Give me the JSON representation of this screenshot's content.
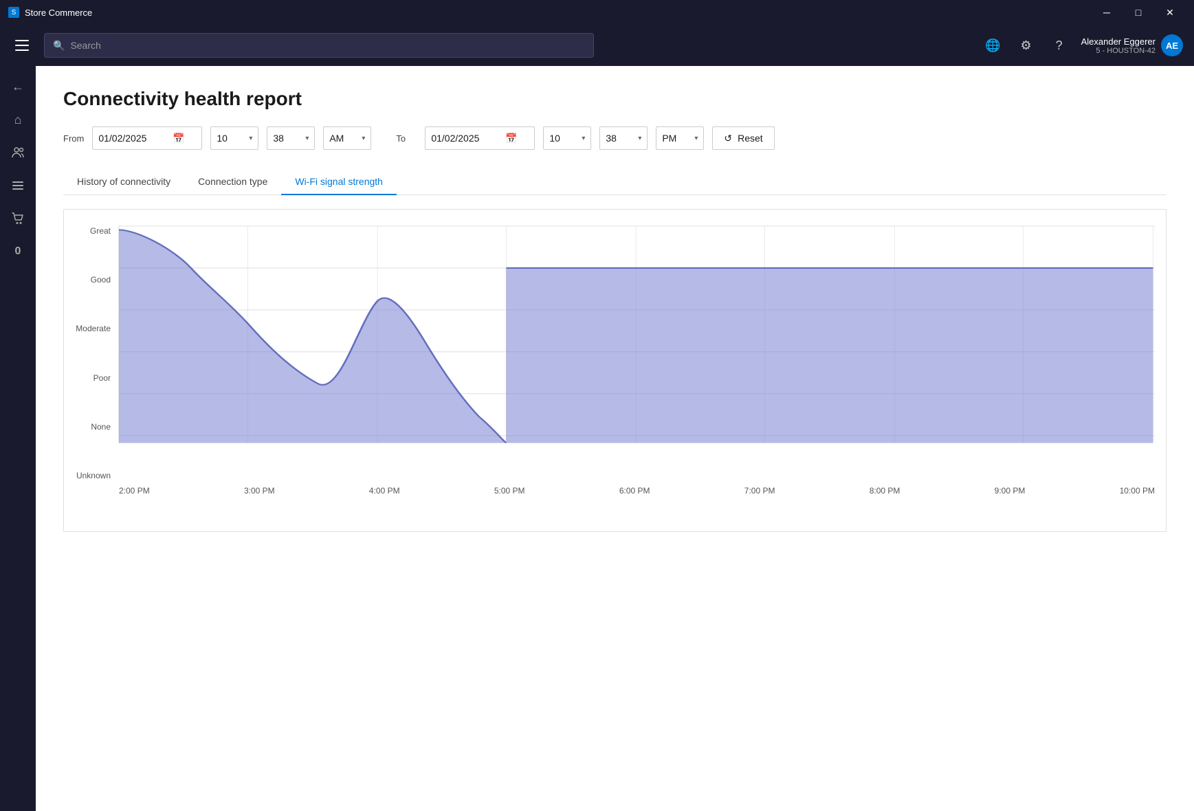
{
  "titleBar": {
    "appName": "Store Commerce",
    "controls": {
      "minimize": "─",
      "maximize": "□",
      "close": "✕"
    }
  },
  "topNav": {
    "searchPlaceholder": "Search",
    "user": {
      "name": "Alexander Eggerer",
      "subtitle": "5 - HOUSTON-42",
      "initials": "AE"
    }
  },
  "sidebar": {
    "items": [
      {
        "icon": "←",
        "label": "back"
      },
      {
        "icon": "⌂",
        "label": "home"
      },
      {
        "icon": "☰",
        "label": "clients"
      },
      {
        "icon": "≡",
        "label": "menu"
      },
      {
        "icon": "🛍",
        "label": "cart"
      },
      {
        "icon": "0",
        "label": "zero"
      }
    ]
  },
  "page": {
    "title": "Connectivity health report",
    "from": {
      "label": "From",
      "date": "01/02/2025",
      "hour": "10",
      "minute": "38",
      "ampm": "AM"
    },
    "to": {
      "label": "To",
      "date": "01/02/2025",
      "hour": "10",
      "minute": "38",
      "ampm": "PM"
    },
    "resetLabel": "Reset"
  },
  "tabs": [
    {
      "id": "history",
      "label": "History of connectivity",
      "active": false
    },
    {
      "id": "connection",
      "label": "Connection type",
      "active": false
    },
    {
      "id": "wifi",
      "label": "Wi-Fi signal strength",
      "active": true
    }
  ],
  "chart": {
    "yLabels": [
      "Great",
      "Good",
      "Moderate",
      "Poor",
      "None",
      "Unknown"
    ],
    "xLabels": [
      "2:00 PM",
      "3:00 PM",
      "4:00 PM",
      "5:00 PM",
      "6:00 PM",
      "7:00 PM",
      "8:00 PM",
      "9:00 PM",
      "10:00 PM"
    ],
    "fillColor": "rgba(120, 130, 210, 0.65)",
    "strokeColor": "rgba(80, 90, 180, 0.9)"
  }
}
